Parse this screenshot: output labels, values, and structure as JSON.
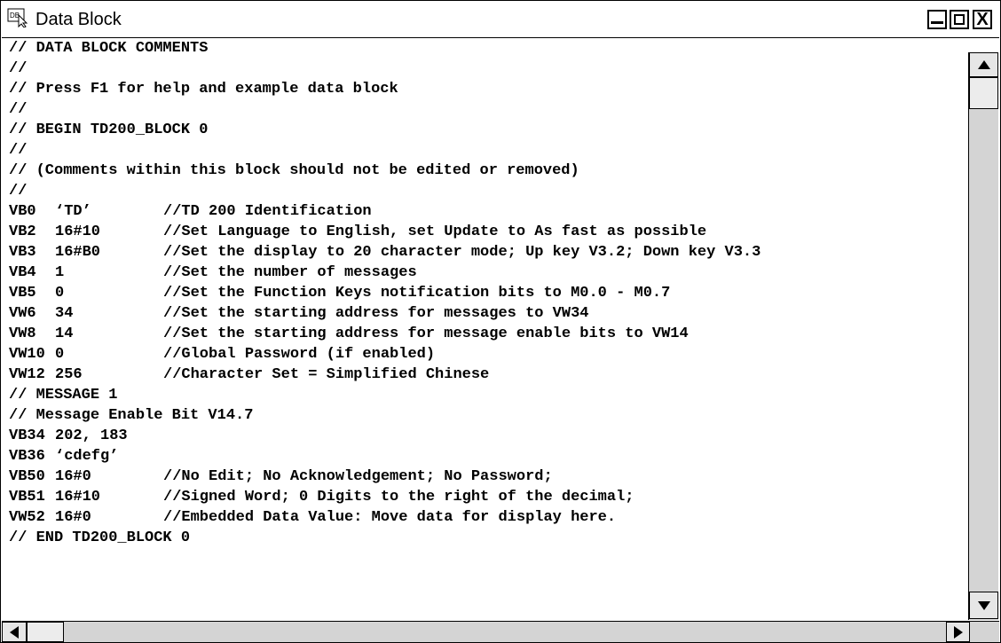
{
  "window": {
    "title": "Data Block",
    "icon_label": "DB",
    "buttons": {
      "minimize": "minimize",
      "maximize": "maximize",
      "close": "X"
    }
  },
  "code_lines": [
    {
      "c1": "",
      "c2": "",
      "c3": "// DATA BLOCK COMMENTS"
    },
    {
      "c1": "",
      "c2": "",
      "c3": "//"
    },
    {
      "c1": "",
      "c2": "",
      "c3": "// Press F1 for help and example data block"
    },
    {
      "c1": "",
      "c2": "",
      "c3": "//"
    },
    {
      "c1": "",
      "c2": "",
      "c3": "// BEGIN TD200_BLOCK 0"
    },
    {
      "c1": "",
      "c2": "",
      "c3": "//"
    },
    {
      "c1": "",
      "c2": "",
      "c3": "// (Comments within this block should not be edited or removed)"
    },
    {
      "c1": "",
      "c2": "",
      "c3": "//"
    },
    {
      "c1": "VB0",
      "c2": "‘TD’",
      "c3": "//TD 200 Identification"
    },
    {
      "c1": "VB2",
      "c2": "16#10",
      "c3": "//Set Language to English, set Update to As fast as possible"
    },
    {
      "c1": "VB3",
      "c2": "16#B0",
      "c3": "//Set the display to 20 character mode; Up key V3.2; Down key V3.3"
    },
    {
      "c1": "VB4",
      "c2": "1",
      "c3": "//Set the number of messages"
    },
    {
      "c1": "VB5",
      "c2": "0",
      "c3": "//Set the Function Keys notification bits to M0.0 - M0.7"
    },
    {
      "c1": "VW6",
      "c2": "34",
      "c3": "//Set the starting address for messages to VW34"
    },
    {
      "c1": "VW8",
      "c2": "14",
      "c3": "//Set the starting address for message enable bits to VW14"
    },
    {
      "c1": "VW10",
      "c2": "0",
      "c3": "//Global Password (if enabled)"
    },
    {
      "c1": "VW12",
      "c2": "256",
      "c3": "//Character Set = Simplified Chinese"
    },
    {
      "c1": "",
      "c2": "",
      "c3": "// MESSAGE 1"
    },
    {
      "c1": "",
      "c2": "",
      "c3": "// Message Enable Bit V14.7"
    },
    {
      "c1": "VB34",
      "c2": "202, 183",
      "c3": ""
    },
    {
      "c1": "VB36",
      "c2": "‘cdefg’",
      "c3": ""
    },
    {
      "c1": "VB50",
      "c2": "16#0",
      "c3": "//No Edit; No Acknowledgement; No Password;"
    },
    {
      "c1": "VB51",
      "c2": "16#10",
      "c3": "//Signed Word; 0 Digits to the right of the decimal;"
    },
    {
      "c1": "VW52",
      "c2": "16#0",
      "c3": "//Embedded Data Value: Move data for display here."
    },
    {
      "c1": "",
      "c2": "",
      "c3": "// END TD200_BLOCK 0"
    }
  ],
  "scrollbars": {
    "vertical": {
      "up_icon": "triangle-up-icon",
      "down_icon": "triangle-down-icon",
      "position": 0.0
    },
    "horizontal": {
      "left_icon": "triangle-left-icon",
      "right_icon": "triangle-right-icon",
      "position": 0.0
    }
  },
  "colors": {
    "background": "#ffffff",
    "text": "#000000",
    "scrollbar": "#d4d4d4"
  }
}
